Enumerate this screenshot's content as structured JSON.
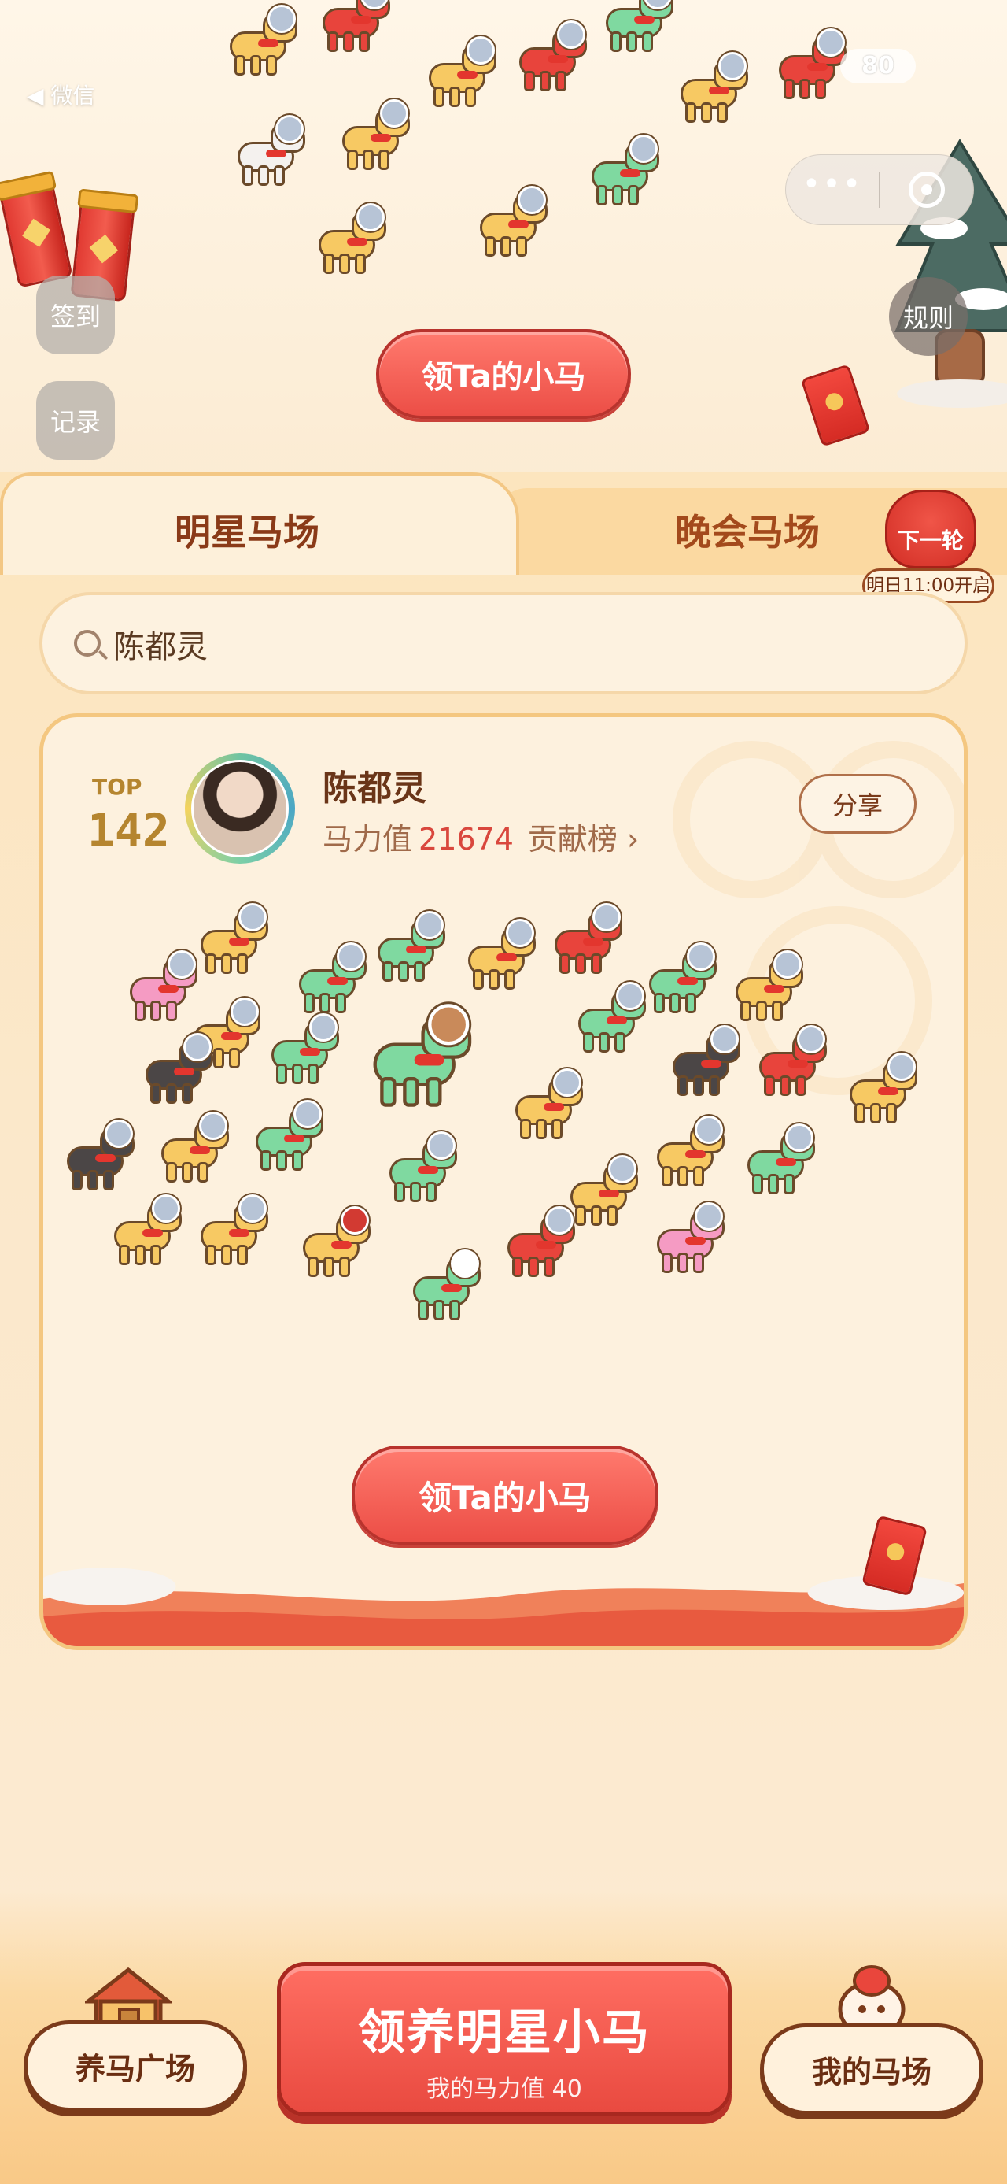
{
  "status_bar": {
    "back_label": "◀ 微信",
    "battery": "80"
  },
  "mini_program_capsule": {
    "more_icon": "more-dots-icon",
    "close_icon": "target-close-icon"
  },
  "top_scene": {
    "checkin_label": "签到",
    "records_label": "记录",
    "rules_label": "规则",
    "claim_button": "领Ta的小马"
  },
  "tabs": [
    {
      "label": "明星马场",
      "active": true
    },
    {
      "label": "晚会马场",
      "active": false
    }
  ],
  "next_round": {
    "label": "下一轮",
    "time": "明日11:00开启"
  },
  "search": {
    "value": "陈都灵",
    "icon": "search-icon"
  },
  "celebrity_card": {
    "rank_prefix": "TOP",
    "rank": "142",
    "name": "陈都灵",
    "power_label": "马力值",
    "power_value": "21674",
    "contrib_label": "贡献榜",
    "share_label": "分享",
    "claim_button": "领Ta的小马"
  },
  "bottom_nav": {
    "left_label": "养马广场",
    "main_title": "领养明星小马",
    "main_subtitle": "我的马力值 40",
    "right_label": "我的马场"
  },
  "colors": {
    "accent_red": "#EC4E46",
    "panel_bg": "#FCE5BE",
    "text_brown": "#6A3518",
    "highlight_value": "#D9473D"
  }
}
